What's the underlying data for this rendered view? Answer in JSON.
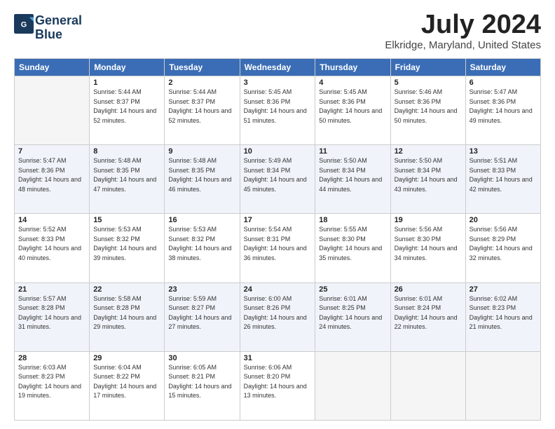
{
  "logo": {
    "line1": "General",
    "line2": "Blue"
  },
  "title": "July 2024",
  "location": "Elkridge, Maryland, United States",
  "weekdays": [
    "Sunday",
    "Monday",
    "Tuesday",
    "Wednesday",
    "Thursday",
    "Friday",
    "Saturday"
  ],
  "weeks": [
    [
      {
        "day": "",
        "sunrise": "",
        "sunset": "",
        "daylight": ""
      },
      {
        "day": "1",
        "sunrise": "Sunrise: 5:44 AM",
        "sunset": "Sunset: 8:37 PM",
        "daylight": "Daylight: 14 hours and 52 minutes."
      },
      {
        "day": "2",
        "sunrise": "Sunrise: 5:44 AM",
        "sunset": "Sunset: 8:37 PM",
        "daylight": "Daylight: 14 hours and 52 minutes."
      },
      {
        "day": "3",
        "sunrise": "Sunrise: 5:45 AM",
        "sunset": "Sunset: 8:36 PM",
        "daylight": "Daylight: 14 hours and 51 minutes."
      },
      {
        "day": "4",
        "sunrise": "Sunrise: 5:45 AM",
        "sunset": "Sunset: 8:36 PM",
        "daylight": "Daylight: 14 hours and 50 minutes."
      },
      {
        "day": "5",
        "sunrise": "Sunrise: 5:46 AM",
        "sunset": "Sunset: 8:36 PM",
        "daylight": "Daylight: 14 hours and 50 minutes."
      },
      {
        "day": "6",
        "sunrise": "Sunrise: 5:47 AM",
        "sunset": "Sunset: 8:36 PM",
        "daylight": "Daylight: 14 hours and 49 minutes."
      }
    ],
    [
      {
        "day": "7",
        "sunrise": "Sunrise: 5:47 AM",
        "sunset": "Sunset: 8:36 PM",
        "daylight": "Daylight: 14 hours and 48 minutes."
      },
      {
        "day": "8",
        "sunrise": "Sunrise: 5:48 AM",
        "sunset": "Sunset: 8:35 PM",
        "daylight": "Daylight: 14 hours and 47 minutes."
      },
      {
        "day": "9",
        "sunrise": "Sunrise: 5:48 AM",
        "sunset": "Sunset: 8:35 PM",
        "daylight": "Daylight: 14 hours and 46 minutes."
      },
      {
        "day": "10",
        "sunrise": "Sunrise: 5:49 AM",
        "sunset": "Sunset: 8:34 PM",
        "daylight": "Daylight: 14 hours and 45 minutes."
      },
      {
        "day": "11",
        "sunrise": "Sunrise: 5:50 AM",
        "sunset": "Sunset: 8:34 PM",
        "daylight": "Daylight: 14 hours and 44 minutes."
      },
      {
        "day": "12",
        "sunrise": "Sunrise: 5:50 AM",
        "sunset": "Sunset: 8:34 PM",
        "daylight": "Daylight: 14 hours and 43 minutes."
      },
      {
        "day": "13",
        "sunrise": "Sunrise: 5:51 AM",
        "sunset": "Sunset: 8:33 PM",
        "daylight": "Daylight: 14 hours and 42 minutes."
      }
    ],
    [
      {
        "day": "14",
        "sunrise": "Sunrise: 5:52 AM",
        "sunset": "Sunset: 8:33 PM",
        "daylight": "Daylight: 14 hours and 40 minutes."
      },
      {
        "day": "15",
        "sunrise": "Sunrise: 5:53 AM",
        "sunset": "Sunset: 8:32 PM",
        "daylight": "Daylight: 14 hours and 39 minutes."
      },
      {
        "day": "16",
        "sunrise": "Sunrise: 5:53 AM",
        "sunset": "Sunset: 8:32 PM",
        "daylight": "Daylight: 14 hours and 38 minutes."
      },
      {
        "day": "17",
        "sunrise": "Sunrise: 5:54 AM",
        "sunset": "Sunset: 8:31 PM",
        "daylight": "Daylight: 14 hours and 36 minutes."
      },
      {
        "day": "18",
        "sunrise": "Sunrise: 5:55 AM",
        "sunset": "Sunset: 8:30 PM",
        "daylight": "Daylight: 14 hours and 35 minutes."
      },
      {
        "day": "19",
        "sunrise": "Sunrise: 5:56 AM",
        "sunset": "Sunset: 8:30 PM",
        "daylight": "Daylight: 14 hours and 34 minutes."
      },
      {
        "day": "20",
        "sunrise": "Sunrise: 5:56 AM",
        "sunset": "Sunset: 8:29 PM",
        "daylight": "Daylight: 14 hours and 32 minutes."
      }
    ],
    [
      {
        "day": "21",
        "sunrise": "Sunrise: 5:57 AM",
        "sunset": "Sunset: 8:28 PM",
        "daylight": "Daylight: 14 hours and 31 minutes."
      },
      {
        "day": "22",
        "sunrise": "Sunrise: 5:58 AM",
        "sunset": "Sunset: 8:28 PM",
        "daylight": "Daylight: 14 hours and 29 minutes."
      },
      {
        "day": "23",
        "sunrise": "Sunrise: 5:59 AM",
        "sunset": "Sunset: 8:27 PM",
        "daylight": "Daylight: 14 hours and 27 minutes."
      },
      {
        "day": "24",
        "sunrise": "Sunrise: 6:00 AM",
        "sunset": "Sunset: 8:26 PM",
        "daylight": "Daylight: 14 hours and 26 minutes."
      },
      {
        "day": "25",
        "sunrise": "Sunrise: 6:01 AM",
        "sunset": "Sunset: 8:25 PM",
        "daylight": "Daylight: 14 hours and 24 minutes."
      },
      {
        "day": "26",
        "sunrise": "Sunrise: 6:01 AM",
        "sunset": "Sunset: 8:24 PM",
        "daylight": "Daylight: 14 hours and 22 minutes."
      },
      {
        "day": "27",
        "sunrise": "Sunrise: 6:02 AM",
        "sunset": "Sunset: 8:23 PM",
        "daylight": "Daylight: 14 hours and 21 minutes."
      }
    ],
    [
      {
        "day": "28",
        "sunrise": "Sunrise: 6:03 AM",
        "sunset": "Sunset: 8:23 PM",
        "daylight": "Daylight: 14 hours and 19 minutes."
      },
      {
        "day": "29",
        "sunrise": "Sunrise: 6:04 AM",
        "sunset": "Sunset: 8:22 PM",
        "daylight": "Daylight: 14 hours and 17 minutes."
      },
      {
        "day": "30",
        "sunrise": "Sunrise: 6:05 AM",
        "sunset": "Sunset: 8:21 PM",
        "daylight": "Daylight: 14 hours and 15 minutes."
      },
      {
        "day": "31",
        "sunrise": "Sunrise: 6:06 AM",
        "sunset": "Sunset: 8:20 PM",
        "daylight": "Daylight: 14 hours and 13 minutes."
      },
      {
        "day": "",
        "sunrise": "",
        "sunset": "",
        "daylight": ""
      },
      {
        "day": "",
        "sunrise": "",
        "sunset": "",
        "daylight": ""
      },
      {
        "day": "",
        "sunrise": "",
        "sunset": "",
        "daylight": ""
      }
    ]
  ]
}
